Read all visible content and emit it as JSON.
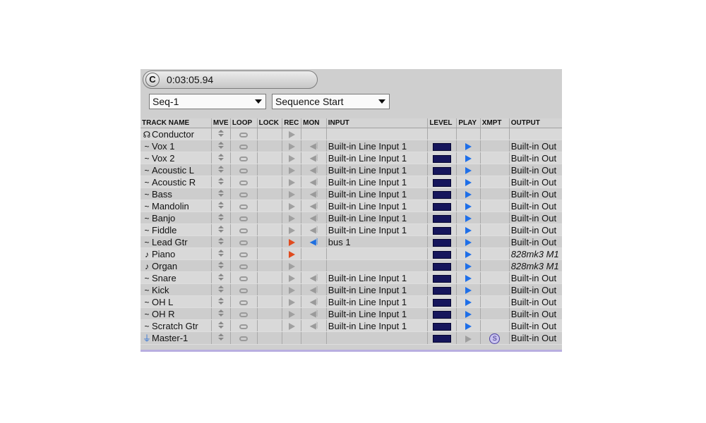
{
  "counter": {
    "button_label": "C",
    "time": "0:03:05.94"
  },
  "dropdowns": {
    "sequence": "Seq-1",
    "position": "Sequence Start"
  },
  "columns": [
    "TRACK NAME",
    "MVE",
    "LOOP",
    "LOCK",
    "REC",
    "MON",
    "INPUT",
    "LEVEL",
    "PLAY",
    "XMPT",
    "OUTPUT"
  ],
  "colors": {
    "accent_play": "#1f6fe8",
    "rec_armed": "#e04b1f",
    "monitor_on": "#1e6fe0",
    "level_meter": "#16165c"
  },
  "tracks": [
    {
      "type": "conductor",
      "type_icon": "conductor-icon",
      "name": "Conductor",
      "rec": "dim",
      "mon": "",
      "input": "",
      "level": false,
      "play": "",
      "xmpt": "",
      "output": "",
      "output_italic": false
    },
    {
      "type": "audio",
      "type_icon": "audio-track-icon",
      "name": "Vox 1",
      "rec": "dim",
      "mon": "off",
      "input": "Built-in Line Input 1",
      "level": true,
      "play": "on",
      "xmpt": "",
      "output": "Built-in Out",
      "output_italic": false
    },
    {
      "type": "audio",
      "type_icon": "audio-track-icon",
      "name": "Vox 2",
      "rec": "dim",
      "mon": "off",
      "input": "Built-in Line Input 1",
      "level": true,
      "play": "on",
      "xmpt": "",
      "output": "Built-in Out",
      "output_italic": false
    },
    {
      "type": "audio",
      "type_icon": "audio-track-icon",
      "name": "Acoustic L",
      "rec": "dim",
      "mon": "off",
      "input": "Built-in Line Input 1",
      "level": true,
      "play": "on",
      "xmpt": "",
      "output": "Built-in Out",
      "output_italic": false
    },
    {
      "type": "audio",
      "type_icon": "audio-track-icon",
      "name": "Acoustic R",
      "rec": "dim",
      "mon": "off",
      "input": "Built-in Line Input 1",
      "level": true,
      "play": "on",
      "xmpt": "",
      "output": "Built-in Out",
      "output_italic": false
    },
    {
      "type": "audio",
      "type_icon": "audio-track-icon",
      "name": "Bass",
      "rec": "dim",
      "mon": "off",
      "input": "Built-in Line Input 1",
      "level": true,
      "play": "on",
      "xmpt": "",
      "output": "Built-in Out",
      "output_italic": false
    },
    {
      "type": "audio",
      "type_icon": "audio-track-icon",
      "name": "Mandolin",
      "rec": "dim",
      "mon": "off",
      "input": "Built-in Line Input 1",
      "level": true,
      "play": "on",
      "xmpt": "",
      "output": "Built-in Out",
      "output_italic": false
    },
    {
      "type": "audio",
      "type_icon": "audio-track-icon",
      "name": "Banjo",
      "rec": "dim",
      "mon": "off",
      "input": "Built-in Line Input 1",
      "level": true,
      "play": "on",
      "xmpt": "",
      "output": "Built-in Out",
      "output_italic": false
    },
    {
      "type": "audio",
      "type_icon": "audio-track-icon",
      "name": "Fiddle",
      "rec": "dim",
      "mon": "off",
      "input": "Built-in Line Input 1",
      "level": true,
      "play": "on",
      "xmpt": "",
      "output": "Built-in Out",
      "output_italic": false
    },
    {
      "type": "audio",
      "type_icon": "audio-track-icon",
      "name": "Lead Gtr",
      "rec": "armed",
      "mon": "on",
      "input": "bus 1",
      "level": true,
      "play": "on",
      "xmpt": "",
      "output": "Built-in Out",
      "output_italic": false
    },
    {
      "type": "midi",
      "type_icon": "midi-note-icon",
      "name": "Piano",
      "rec": "armed",
      "mon": "",
      "input": "",
      "level": true,
      "play": "on",
      "xmpt": "",
      "output": "828mk3 M1",
      "output_italic": true
    },
    {
      "type": "midi",
      "type_icon": "midi-note-icon",
      "name": "Organ",
      "rec": "dim",
      "mon": "",
      "input": "",
      "level": true,
      "play": "on",
      "xmpt": "",
      "output": "828mk3 M1",
      "output_italic": true
    },
    {
      "type": "audio",
      "type_icon": "audio-track-icon",
      "name": "Snare",
      "rec": "dim",
      "mon": "off",
      "input": "Built-in Line Input 1",
      "level": true,
      "play": "on",
      "xmpt": "",
      "output": "Built-in Out",
      "output_italic": false
    },
    {
      "type": "audio",
      "type_icon": "audio-track-icon",
      "name": "Kick",
      "rec": "dim",
      "mon": "off",
      "input": "Built-in Line Input 1",
      "level": true,
      "play": "on",
      "xmpt": "",
      "output": "Built-in Out",
      "output_italic": false
    },
    {
      "type": "audio",
      "type_icon": "audio-track-icon",
      "name": "OH L",
      "rec": "dim",
      "mon": "off",
      "input": "Built-in Line Input 1",
      "level": true,
      "play": "on",
      "xmpt": "",
      "output": "Built-in Out",
      "output_italic": false
    },
    {
      "type": "audio",
      "type_icon": "audio-track-icon",
      "name": "OH R",
      "rec": "dim",
      "mon": "off",
      "input": "Built-in Line Input 1",
      "level": true,
      "play": "on",
      "xmpt": "",
      "output": "Built-in Out",
      "output_italic": false
    },
    {
      "type": "audio",
      "type_icon": "audio-track-icon",
      "name": "Scratch Gtr",
      "rec": "dim",
      "mon": "off",
      "input": "Built-in Line Input 1",
      "level": true,
      "play": "on",
      "xmpt": "",
      "output": "Built-in Out",
      "output_italic": false
    },
    {
      "type": "master",
      "type_icon": "master-fader-icon",
      "name": "Master-1",
      "rec": "",
      "mon": "",
      "input": "",
      "level": true,
      "play": "dim",
      "xmpt": "S",
      "output": "Built-in Out",
      "output_italic": false
    }
  ]
}
